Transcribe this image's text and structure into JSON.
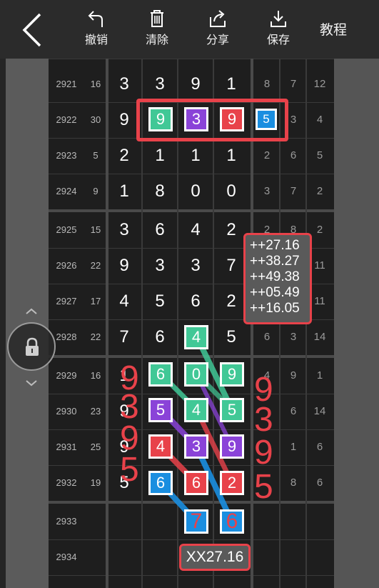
{
  "toolbar": {
    "undo_label": "撤销",
    "clear_label": "清除",
    "share_label": "分享",
    "save_label": "保存",
    "tutorial_label": "教程"
  },
  "rows": [
    {
      "issue": "2921",
      "sum": "16",
      "digits": [
        "3",
        "3",
        "9",
        "1"
      ],
      "right": [
        "8",
        "7",
        "12"
      ]
    },
    {
      "issue": "2922",
      "sum": "30",
      "digits": [
        "9",
        "9",
        "3",
        "9"
      ],
      "right": [
        "5",
        "3",
        "4"
      ]
    },
    {
      "issue": "2923",
      "sum": "5",
      "digits": [
        "2",
        "1",
        "1",
        "1"
      ],
      "right": [
        "2",
        "6",
        "5"
      ]
    },
    {
      "issue": "2924",
      "sum": "9",
      "digits": [
        "1",
        "8",
        "0",
        "0"
      ],
      "right": [
        "3",
        "7",
        "2"
      ]
    },
    {
      "issue": "2925",
      "sum": "15",
      "digits": [
        "3",
        "6",
        "4",
        "2"
      ],
      "right": [
        "2",
        "8",
        "2"
      ]
    },
    {
      "issue": "2926",
      "sum": "22",
      "digits": [
        "9",
        "3",
        "3",
        "7"
      ],
      "right": [
        "",
        "",
        "11"
      ]
    },
    {
      "issue": "2927",
      "sum": "17",
      "digits": [
        "4",
        "5",
        "6",
        "2"
      ],
      "right": [
        "",
        "",
        "11"
      ]
    },
    {
      "issue": "2928",
      "sum": "22",
      "digits": [
        "7",
        "6",
        "4",
        "5"
      ],
      "right": [
        "6",
        "3",
        "14"
      ]
    },
    {
      "issue": "2929",
      "sum": "16",
      "digits": [
        "1",
        "6",
        "0",
        "9"
      ],
      "right": [
        "4",
        "9",
        "1"
      ]
    },
    {
      "issue": "2930",
      "sum": "23",
      "digits": [
        "9",
        "5",
        "4",
        "5"
      ],
      "right": [
        "",
        "6",
        "14"
      ]
    },
    {
      "issue": "2931",
      "sum": "25",
      "digits": [
        "9",
        "4",
        "3",
        "9"
      ],
      "right": [
        "",
        "1",
        "6"
      ]
    },
    {
      "issue": "2932",
      "sum": "19",
      "digits": [
        "5",
        "6",
        "6",
        "2"
      ],
      "right": [
        "",
        "8",
        "6"
      ]
    },
    {
      "issue": "2933",
      "sum": "",
      "digits": [
        "",
        "",
        "7",
        "6"
      ],
      "right": [
        "",
        "",
        ""
      ]
    },
    {
      "issue": "2934",
      "sum": "",
      "digits": [
        "",
        "",
        "",
        ""
      ],
      "right": [
        "",
        "",
        ""
      ]
    }
  ],
  "annotation": {
    "lines": [
      "++27.16",
      "++38.27",
      "++49.38",
      "++05.49",
      "++16.05"
    ]
  },
  "bottom_note": "XX27.16",
  "red_digits_left": [
    "9",
    "3",
    "9",
    "5"
  ],
  "red_digits_right": [
    "9",
    "3",
    "9",
    "5"
  ],
  "colors": {
    "green": "#41c896",
    "purple": "#8a43d8",
    "red": "#e8424a",
    "blue": "#1a8ee0"
  }
}
